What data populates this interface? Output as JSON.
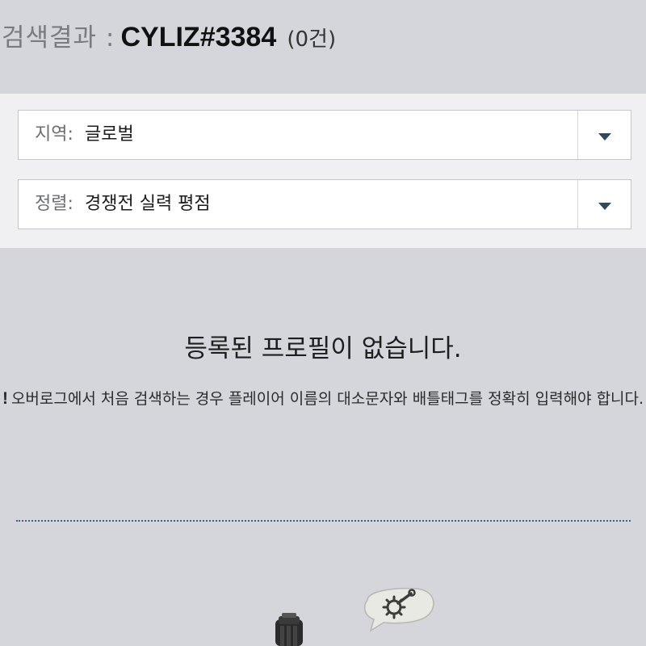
{
  "header": {
    "title_prefix": "검색결과 :",
    "query": "CYLIZ#3384",
    "result_count": "(0건)"
  },
  "filters": {
    "region": {
      "label": "지역:",
      "value": "글로벌",
      "icon": "chevron-down-icon"
    },
    "sort": {
      "label": "정렬:",
      "value": "경쟁전 실력 평점",
      "icon": "chevron-down-icon"
    }
  },
  "empty_state": {
    "title": "등록된 프로필이 없습니다.",
    "notice_mark": "!",
    "notice_text": "오버로그에서 처음 검색하는 경우 플레이어 이름의 대소문자와 배틀태그를 정확히 입력해야 합니다."
  },
  "colors": {
    "background": "#d5d6dc",
    "panel": "#f0f0f2",
    "accent": "#2d4a63",
    "divider": "#3a5f8c"
  }
}
